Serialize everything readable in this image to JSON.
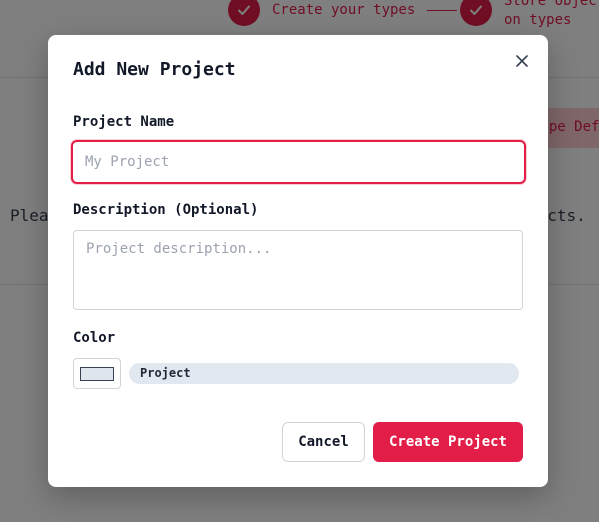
{
  "background": {
    "steps": [
      {
        "label": "Create your types"
      },
      {
        "label": "Store objects on types",
        "line1": "Store object",
        "line2": "on types"
      }
    ],
    "action_button_label": "Type Def",
    "message_left": "Plea",
    "message_right": "jects."
  },
  "modal": {
    "title": "Add New Project",
    "close_label": "×",
    "name_label": "Project Name",
    "name_value": "",
    "name_placeholder": "My Project",
    "description_label": "Description (Optional)",
    "description_value": "",
    "description_placeholder": "Project description...",
    "color_label": "Color",
    "color_value": "#dfe5ed",
    "preview_label": "Project",
    "cancel_label": "Cancel",
    "submit_label": "Create Project"
  },
  "colors": {
    "accent": "#e11d48",
    "accent_light": "#fecdd3",
    "preview_background": "#e2e8f0"
  }
}
